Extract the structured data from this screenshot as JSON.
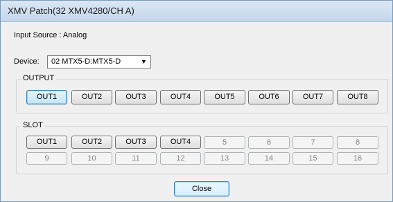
{
  "window": {
    "title": "XMV Patch(32 XMV4280/CH A)"
  },
  "input_source": "Input Source : Analog",
  "device": {
    "label": "Device:",
    "selected": "02 MTX5-D:MTX5-D"
  },
  "output": {
    "legend": "OUTPUT",
    "buttons": [
      "OUT1",
      "OUT2",
      "OUT3",
      "OUT4",
      "OUT5",
      "OUT6",
      "OUT7",
      "OUT8"
    ],
    "selected": "OUT1"
  },
  "slot": {
    "legend": "SLOT",
    "row1": [
      "OUT1",
      "OUT2",
      "OUT3",
      "OUT4",
      "5",
      "6",
      "7",
      "8"
    ],
    "row2": [
      "9",
      "10",
      "11",
      "12",
      "13",
      "14",
      "15",
      "16"
    ]
  },
  "close_label": "Close"
}
